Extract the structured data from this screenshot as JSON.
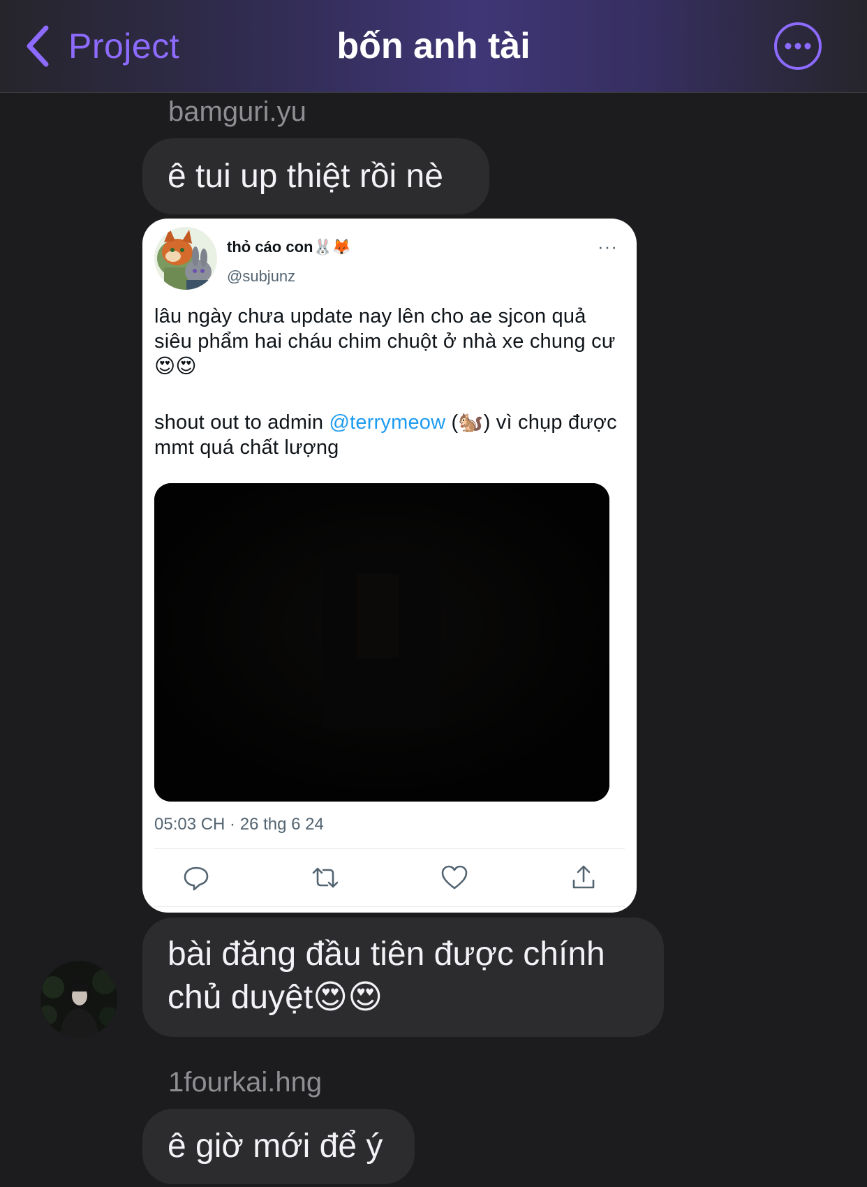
{
  "header": {
    "back_label": "Project",
    "title": "bốn anh tài"
  },
  "messages": [
    {
      "sender": "bamguri.yu",
      "text": "ê tui up thiệt rồi nè"
    },
    {
      "text": "bài đăng đầu tiên được chính chủ duyệt😍😍"
    },
    {
      "sender": "1fourkai.hng",
      "text": "ê giờ mới để ý"
    }
  ],
  "tweet": {
    "display_name": "thỏ cáo con🐰🦊",
    "handle": "@subjunz",
    "more": "···",
    "text_line1": "lâu ngày chưa update nay lên cho ae sjcon quả siêu phẩm hai cháu chim chuột ở nhà xe chung cư😍😍",
    "text_before_mention": "shout out to admin ",
    "mention": "@terrymeow",
    "text_after_mention": " (🐿️) vì chụp được mmt quá chất lượng",
    "timestamp": "05:03 CH · 26 thg 6 24",
    "actions": [
      "reply-icon",
      "retweet-icon",
      "like-icon",
      "share-icon"
    ]
  },
  "colors": {
    "accent": "#8d6bff",
    "background": "#1c1c1e",
    "bubble": "#2c2c2e",
    "mention": "#1d9bf0"
  }
}
